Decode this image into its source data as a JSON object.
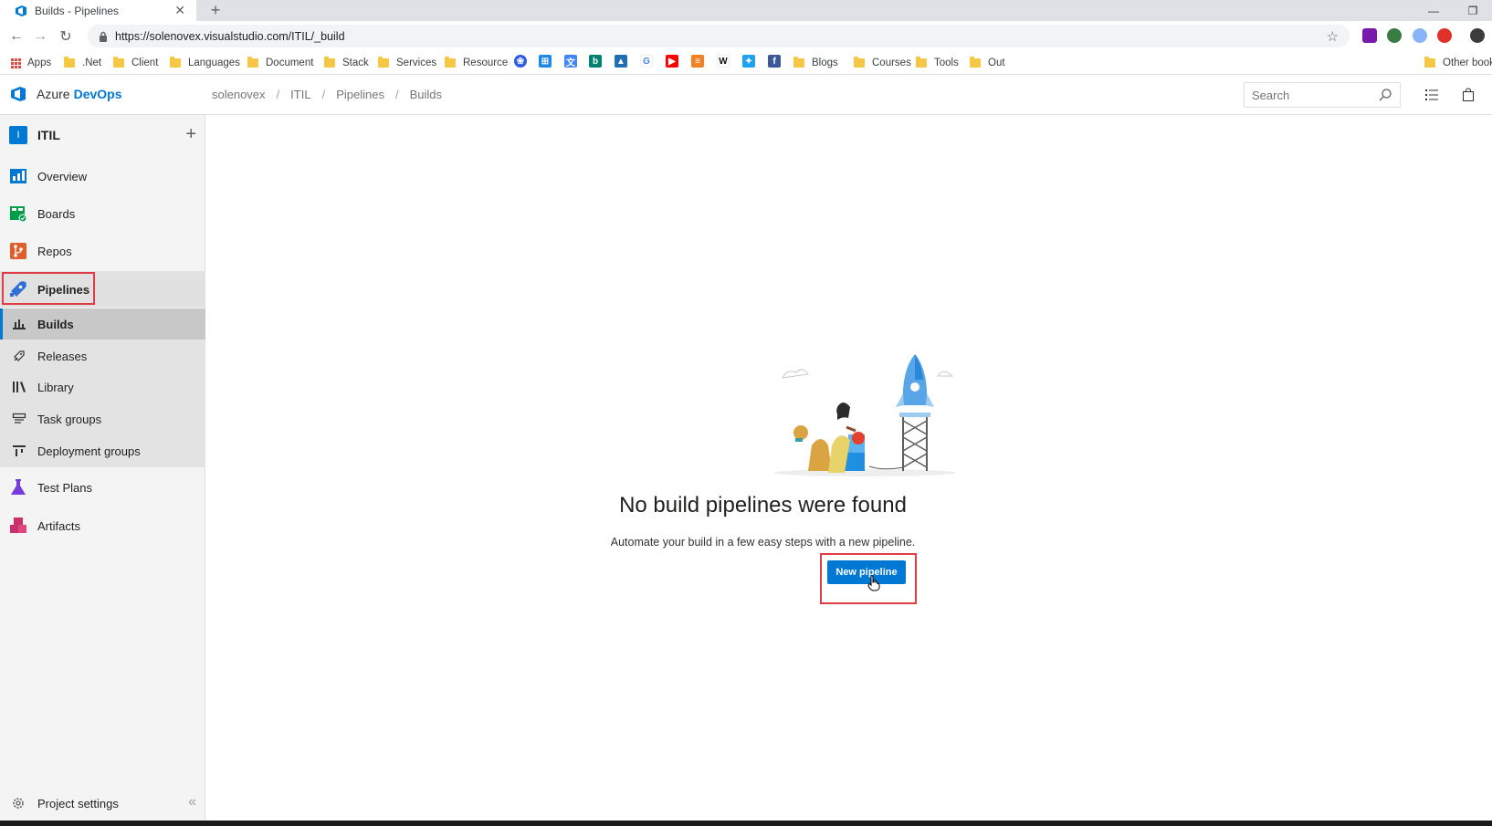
{
  "browser": {
    "tab_title": "Builds - Pipelines",
    "new_tab": "+",
    "url": "https://solenovex.visualstudio.com/ITIL/_build",
    "bookmarks": [
      ".Net",
      "Client",
      "Languages",
      "Document",
      "Stack",
      "Services",
      "Resource",
      "Blogs",
      "Courses",
      "Tools",
      "Out"
    ],
    "apps_label": "Apps",
    "other_bookmarks": "Other book",
    "icon_letters": [
      "b",
      "G",
      "W"
    ]
  },
  "header": {
    "brand_prefix": "Azure",
    "brand_suffix": "DevOps",
    "breadcrumb": [
      "solenovex",
      "ITIL",
      "Pipelines",
      "Builds"
    ],
    "search_placeholder": "Search"
  },
  "sidebar": {
    "project_initial": "I",
    "project_name": "ITIL",
    "items": [
      {
        "label": "Overview",
        "icon": "overview-icon"
      },
      {
        "label": "Boards",
        "icon": "boards-icon"
      },
      {
        "label": "Repos",
        "icon": "repos-icon"
      },
      {
        "label": "Pipelines",
        "icon": "pipelines-icon"
      },
      {
        "label": "Test Plans",
        "icon": "test-plans-icon"
      },
      {
        "label": "Artifacts",
        "icon": "artifacts-icon"
      }
    ],
    "pipeline_subitems": [
      "Builds",
      "Releases",
      "Library",
      "Task groups",
      "Deployment groups"
    ],
    "project_settings": "Project settings"
  },
  "main": {
    "empty_title": "No build pipelines were found",
    "empty_subtitle": "Automate your build in a few easy steps with a new pipeline.",
    "cta_label": "New pipeline"
  },
  "colors": {
    "accent": "#0078d4",
    "highlight": "#e13b45"
  }
}
